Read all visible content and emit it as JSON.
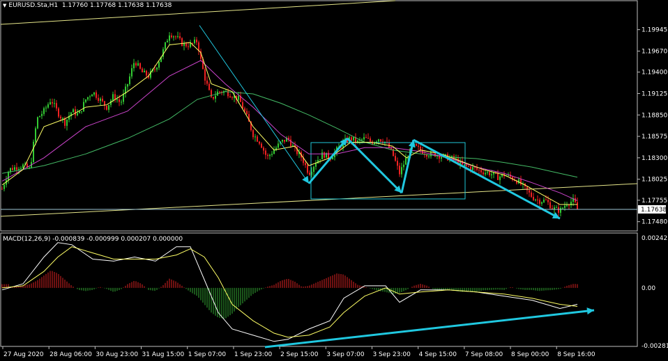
{
  "header": {
    "symbol": "EURUSD.Sta,H1",
    "ohlc": "1.17760 1.17768 1.17638 1.17638"
  },
  "indicator_header": "MACD(12,26,9) -0.000839 -0.000999 0.000207 0.000000",
  "colors": {
    "background": "#000000",
    "frame": "#c0c0c0",
    "bull": "#33cc33",
    "bear": "#ee2222",
    "ma_fast": "#ffff66",
    "ma_mid": "#cc44cc",
    "ma_slow": "#44bb66",
    "trendline": "#e6e68a",
    "box": "#20c8d8",
    "arrow": "#20c8e0",
    "price_line": "#a0c8d8",
    "macd_hist_pos": "#dd2222",
    "macd_hist_neg": "#33aa33",
    "macd_main": "#ffffff",
    "macd_signal": "#ffff66"
  },
  "chart_data": [
    {
      "type": "candlestick",
      "title": "EURUSD.Sta,H1",
      "current_price": "1.17638",
      "ylim": [
        1.1737,
        1.2029
      ],
      "y_ticks": [
        "1.19945",
        "1.19670",
        "1.19400",
        "1.19125",
        "1.18850",
        "1.18575",
        "1.18300",
        "1.18025",
        "1.17755",
        "1.17480"
      ],
      "x_ticks": [
        "27 Aug 2020",
        "28 Aug 06:00",
        "30 Aug 23:00",
        "31 Aug 15:00",
        "1 Sep 07:00",
        "1 Sep 23:00",
        "2 Sep 15:00",
        "3 Sep 07:00",
        "3 Sep 23:00",
        "4 Sep 15:00",
        "7 Sep 08:00",
        "8 Sep 00:00",
        "8 Sep 16:00"
      ],
      "close_path": [
        [
          0,
          1.179
        ],
        [
          10,
          1.1815
        ],
        [
          20,
          1.1818
        ],
        [
          30,
          1.182
        ],
        [
          40,
          1.1815
        ],
        [
          50,
          1.188
        ],
        [
          60,
          1.189
        ],
        [
          70,
          1.1905
        ],
        [
          80,
          1.1888
        ],
        [
          90,
          1.1875
        ],
        [
          100,
          1.189
        ],
        [
          110,
          1.1885
        ],
        [
          120,
          1.1905
        ],
        [
          130,
          1.1915
        ],
        [
          140,
          1.1905
        ],
        [
          150,
          1.1895
        ],
        [
          160,
          1.191
        ],
        [
          170,
          1.19
        ],
        [
          180,
          1.1925
        ],
        [
          190,
          1.1955
        ],
        [
          200,
          1.194
        ],
        [
          210,
          1.1935
        ],
        [
          220,
          1.1945
        ],
        [
          230,
          1.1965
        ],
        [
          240,
          1.199
        ],
        [
          250,
          1.1985
        ],
        [
          260,
          1.1975
        ],
        [
          270,
          1.1975
        ],
        [
          280,
          1.198
        ],
        [
          285,
          1.1955
        ],
        [
          290,
          1.1935
        ],
        [
          300,
          1.1905
        ],
        [
          310,
          1.1915
        ],
        [
          320,
          1.1915
        ],
        [
          330,
          1.191
        ],
        [
          340,
          1.1905
        ],
        [
          350,
          1.1885
        ],
        [
          360,
          1.186
        ],
        [
          370,
          1.185
        ],
        [
          380,
          1.183
        ],
        [
          390,
          1.184
        ],
        [
          400,
          1.185
        ],
        [
          410,
          1.1855
        ],
        [
          420,
          1.184
        ],
        [
          430,
          1.183
        ],
        [
          440,
          1.181
        ],
        [
          450,
          1.1825
        ],
        [
          460,
          1.1835
        ],
        [
          470,
          1.183
        ],
        [
          480,
          1.184
        ],
        [
          490,
          1.185
        ],
        [
          500,
          1.1855
        ],
        [
          510,
          1.185
        ],
        [
          520,
          1.1855
        ],
        [
          530,
          1.185
        ],
        [
          540,
          1.1855
        ],
        [
          550,
          1.185
        ],
        [
          560,
          1.1835
        ],
        [
          570,
          1.181
        ],
        [
          580,
          1.183
        ],
        [
          590,
          1.1845
        ],
        [
          600,
          1.184
        ],
        [
          610,
          1.1835
        ],
        [
          620,
          1.1835
        ],
        [
          630,
          1.1832
        ],
        [
          640,
          1.183
        ],
        [
          650,
          1.1828
        ],
        [
          660,
          1.182
        ],
        [
          670,
          1.1818
        ],
        [
          680,
          1.1815
        ],
        [
          690,
          1.1812
        ],
        [
          700,
          1.181
        ],
        [
          710,
          1.1805
        ],
        [
          720,
          1.1808
        ],
        [
          730,
          1.1805
        ],
        [
          740,
          1.18
        ],
        [
          750,
          1.179
        ],
        [
          760,
          1.178
        ],
        [
          770,
          1.1775
        ],
        [
          780,
          1.1775
        ],
        [
          790,
          1.1765
        ],
        [
          800,
          1.1762
        ],
        [
          810,
          1.1772
        ],
        [
          820,
          1.1775
        ],
        [
          825,
          1.1764
        ]
      ],
      "ma_fast": [
        [
          0,
          1.1795
        ],
        [
          30,
          1.1815
        ],
        [
          60,
          1.187
        ],
        [
          90,
          1.188
        ],
        [
          120,
          1.1895
        ],
        [
          150,
          1.1898
        ],
        [
          180,
          1.1915
        ],
        [
          210,
          1.1935
        ],
        [
          240,
          1.1975
        ],
        [
          270,
          1.1978
        ],
        [
          285,
          1.1965
        ],
        [
          300,
          1.1925
        ],
        [
          330,
          1.1915
        ],
        [
          360,
          1.187
        ],
        [
          390,
          1.184
        ],
        [
          420,
          1.1845
        ],
        [
          440,
          1.182
        ],
        [
          470,
          1.183
        ],
        [
          500,
          1.185
        ],
        [
          530,
          1.185
        ],
        [
          560,
          1.1845
        ],
        [
          580,
          1.183
        ],
        [
          600,
          1.184
        ],
        [
          630,
          1.1835
        ],
        [
          660,
          1.1825
        ],
        [
          690,
          1.1815
        ],
        [
          720,
          1.1808
        ],
        [
          750,
          1.1795
        ],
        [
          780,
          1.178
        ],
        [
          800,
          1.177
        ],
        [
          825,
          1.177
        ]
      ],
      "ma_mid": [
        [
          0,
          1.18
        ],
        [
          60,
          1.183
        ],
        [
          120,
          1.187
        ],
        [
          180,
          1.189
        ],
        [
          240,
          1.1935
        ],
        [
          285,
          1.1955
        ],
        [
          320,
          1.1925
        ],
        [
          360,
          1.1895
        ],
        [
          400,
          1.186
        ],
        [
          440,
          1.1835
        ],
        [
          480,
          1.1835
        ],
        [
          520,
          1.1843
        ],
        [
          560,
          1.1843
        ],
        [
          600,
          1.1838
        ],
        [
          640,
          1.183
        ],
        [
          680,
          1.1818
        ],
        [
          720,
          1.181
        ],
        [
          760,
          1.1798
        ],
        [
          800,
          1.1785
        ],
        [
          825,
          1.1775
        ]
      ],
      "ma_slow": [
        [
          0,
          1.181
        ],
        [
          60,
          1.182
        ],
        [
          120,
          1.1835
        ],
        [
          180,
          1.1855
        ],
        [
          240,
          1.188
        ],
        [
          280,
          1.1905
        ],
        [
          320,
          1.1915
        ],
        [
          360,
          1.1912
        ],
        [
          400,
          1.19
        ],
        [
          440,
          1.1885
        ],
        [
          480,
          1.1868
        ],
        [
          520,
          1.185
        ],
        [
          560,
          1.184
        ],
        [
          600,
          1.1835
        ],
        [
          640,
          1.1831
        ],
        [
          680,
          1.1829
        ],
        [
          720,
          1.1824
        ],
        [
          760,
          1.1818
        ],
        [
          800,
          1.181
        ],
        [
          825,
          1.1805
        ]
      ]
    },
    {
      "type": "bar",
      "title": "MACD(12,26,9)",
      "values_label": "-0.000839 -0.000999 0.000207 0.000000",
      "ylim": [
        -0.00281,
        0.00243
      ],
      "y_ticks": [
        "0.002427",
        "0.00",
        "-0.002818"
      ],
      "histogram": [
        [
          10,
          3e-05
        ],
        [
          20,
          8e-05
        ],
        [
          30,
          0.00012
        ],
        [
          40,
          0.00018
        ],
        [
          50,
          0.00035
        ],
        [
          60,
          0.0006
        ],
        [
          70,
          0.00085
        ],
        [
          80,
          0.0007
        ],
        [
          90,
          0.0004
        ],
        [
          100,
          0.0001
        ],
        [
          110,
          -0.0001
        ],
        [
          120,
          -0.00015
        ],
        [
          130,
          -0.0001
        ],
        [
          140,
          5e-05
        ],
        [
          150,
          -5e-05
        ],
        [
          160,
          -0.0002
        ],
        [
          170,
          -8e-05
        ],
        [
          180,
          0.00018
        ],
        [
          190,
          0.00035
        ],
        [
          200,
          0.0002
        ],
        [
          210,
          -0.0001
        ],
        [
          220,
          -0.00015
        ],
        [
          230,
          0.0001
        ],
        [
          240,
          0.00045
        ],
        [
          250,
          0.0003
        ],
        [
          260,
          5e-05
        ],
        [
          270,
          -0.0002
        ],
        [
          280,
          -0.0004
        ],
        [
          290,
          -0.0008
        ],
        [
          300,
          -0.0012
        ],
        [
          310,
          -0.00145
        ],
        [
          320,
          -0.0015
        ],
        [
          330,
          -0.00125
        ],
        [
          340,
          -0.0009
        ],
        [
          350,
          -0.0006
        ],
        [
          360,
          -0.0003
        ],
        [
          370,
          -0.0001
        ],
        [
          380,
          5e-05
        ],
        [
          390,
          0.00015
        ],
        [
          400,
          0.00035
        ],
        [
          410,
          0.00045
        ],
        [
          420,
          0.0003
        ],
        [
          430,
          5e-05
        ],
        [
          440,
          0.0001
        ],
        [
          450,
          0.00025
        ],
        [
          460,
          0.0004
        ],
        [
          470,
          0.00055
        ],
        [
          480,
          0.0007
        ],
        [
          490,
          0.00065
        ],
        [
          500,
          0.0004
        ],
        [
          510,
          0.00015
        ],
        [
          520,
          5e-05
        ],
        [
          530,
          -5e-05
        ],
        [
          540,
          -0.00015
        ],
        [
          550,
          -0.0002
        ],
        [
          560,
          -0.0003
        ],
        [
          570,
          -0.00025
        ],
        [
          580,
          -0.0001
        ],
        [
          590,
          0.0001
        ],
        [
          600,
          0.0002
        ],
        [
          610,
          0.0001
        ],
        [
          620,
          -0.0001
        ],
        [
          630,
          -0.00015
        ],
        [
          640,
          -0.0001
        ],
        [
          650,
          -0.00015
        ],
        [
          660,
          -0.0002
        ],
        [
          670,
          -0.00015
        ],
        [
          680,
          -0.00018
        ],
        [
          690,
          -0.00012
        ],
        [
          700,
          -0.0001
        ],
        [
          710,
          -8e-05
        ],
        [
          720,
          -0.0001
        ],
        [
          730,
          5e-05
        ],
        [
          740,
          -5e-05
        ],
        [
          750,
          -0.0001
        ],
        [
          760,
          -0.0001
        ],
        [
          770,
          -0.00015
        ],
        [
          780,
          -0.00012
        ],
        [
          790,
          -0.0001
        ],
        [
          800,
          -5e-05
        ],
        [
          810,
          0.0001
        ],
        [
          820,
          0.0002
        ],
        [
          825,
          0.00018
        ]
      ],
      "macd_line": [
        [
          0,
          -0.0001
        ],
        [
          30,
          0.0002
        ],
        [
          60,
          0.0015
        ],
        [
          80,
          0.0022
        ],
        [
          100,
          0.0021
        ],
        [
          130,
          0.0014
        ],
        [
          160,
          0.0013
        ],
        [
          190,
          0.0015
        ],
        [
          220,
          0.0013
        ],
        [
          250,
          0.002
        ],
        [
          270,
          0.002
        ],
        [
          290,
          0.0004
        ],
        [
          310,
          -0.0012
        ],
        [
          330,
          -0.002
        ],
        [
          360,
          -0.0023
        ],
        [
          390,
          -0.0026
        ],
        [
          410,
          -0.0025
        ],
        [
          440,
          -0.002
        ],
        [
          470,
          -0.0016
        ],
        [
          490,
          -0.0005
        ],
        [
          520,
          0.0001
        ],
        [
          550,
          0.0001
        ],
        [
          570,
          -0.0007
        ],
        [
          600,
          -0.0001
        ],
        [
          640,
          -0.0001
        ],
        [
          680,
          -0.0002
        ],
        [
          720,
          -0.0004
        ],
        [
          760,
          -0.0006
        ],
        [
          800,
          -0.001
        ],
        [
          825,
          -0.0008
        ]
      ],
      "signal_line": [
        [
          0,
          0.0
        ],
        [
          30,
          0.0001
        ],
        [
          60,
          0.0008
        ],
        [
          80,
          0.0015
        ],
        [
          100,
          0.002
        ],
        [
          130,
          0.0017
        ],
        [
          160,
          0.0014
        ],
        [
          190,
          0.0014
        ],
        [
          220,
          0.0014
        ],
        [
          250,
          0.0016
        ],
        [
          270,
          0.0019
        ],
        [
          290,
          0.0015
        ],
        [
          310,
          0.0005
        ],
        [
          330,
          -0.0008
        ],
        [
          360,
          -0.0016
        ],
        [
          390,
          -0.0022
        ],
        [
          410,
          -0.0024
        ],
        [
          440,
          -0.0023
        ],
        [
          470,
          -0.0019
        ],
        [
          490,
          -0.0012
        ],
        [
          520,
          -0.0004
        ],
        [
          550,
          0.0
        ],
        [
          570,
          -0.0003
        ],
        [
          600,
          -0.0002
        ],
        [
          640,
          -0.0001
        ],
        [
          680,
          -0.0002
        ],
        [
          720,
          -0.0003
        ],
        [
          760,
          -0.0005
        ],
        [
          800,
          -0.0008
        ],
        [
          825,
          -0.0009
        ]
      ]
    }
  ]
}
